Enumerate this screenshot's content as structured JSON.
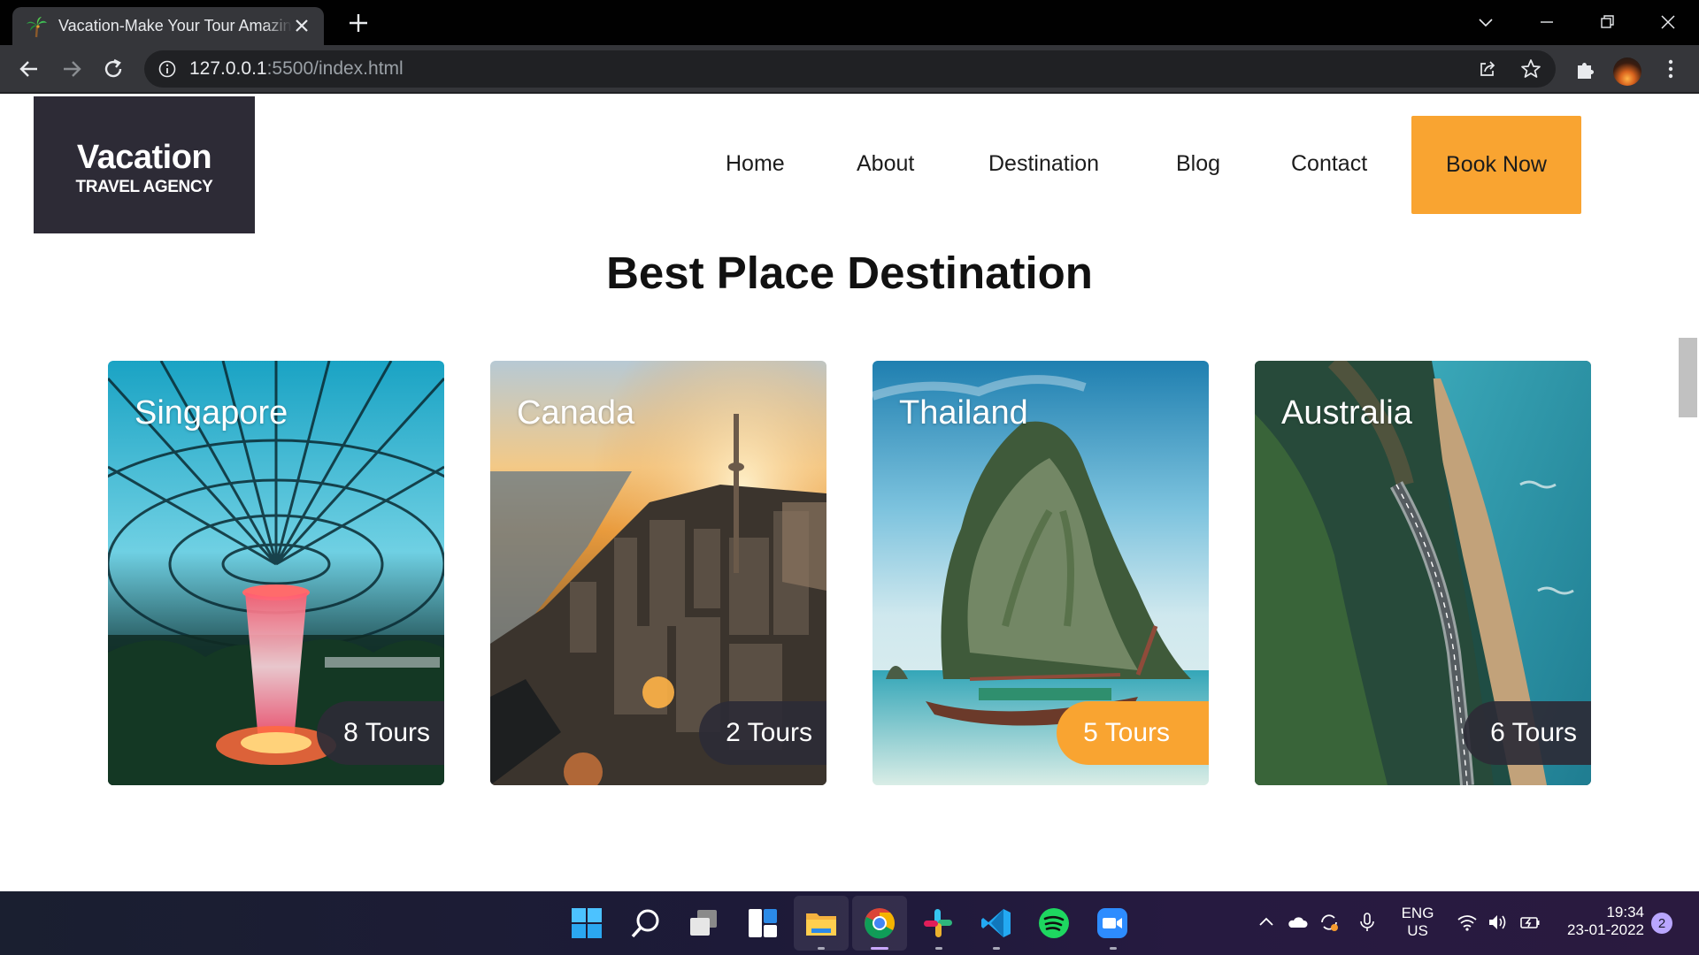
{
  "browser": {
    "tab_title": "Vacation-Make Your Tour Amazing",
    "url_host": "127.0.0.1",
    "url_rest": ":5500/index.html"
  },
  "site": {
    "logo_name": "Vacation",
    "logo_sub": "TRAVEL AGENCY",
    "nav": [
      "Home",
      "About",
      "Destination",
      "Blog",
      "Contact"
    ],
    "cta": "Book Now",
    "section_title": "Best Place Destination",
    "accent_color": "#f9a431",
    "dark_color": "#2d2b36"
  },
  "destinations": [
    {
      "name": "Singapore",
      "tours": "8 Tours",
      "highlight": false
    },
    {
      "name": "Canada",
      "tours": "2 Tours",
      "highlight": false
    },
    {
      "name": "Thailand",
      "tours": "5 Tours",
      "highlight": true
    },
    {
      "name": "Australia",
      "tours": "6 Tours",
      "highlight": false
    }
  ],
  "taskbar": {
    "apps": [
      "start-icon",
      "search-icon",
      "task-view-icon",
      "widgets-icon",
      "file-explorer-icon",
      "chrome-icon",
      "slack-icon",
      "vscode-icon",
      "spotify-icon",
      "zoom-icon"
    ],
    "lang_line1": "ENG",
    "lang_line2": "US",
    "time": "19:34",
    "date": "23-01-2022",
    "notification_count": "2"
  }
}
